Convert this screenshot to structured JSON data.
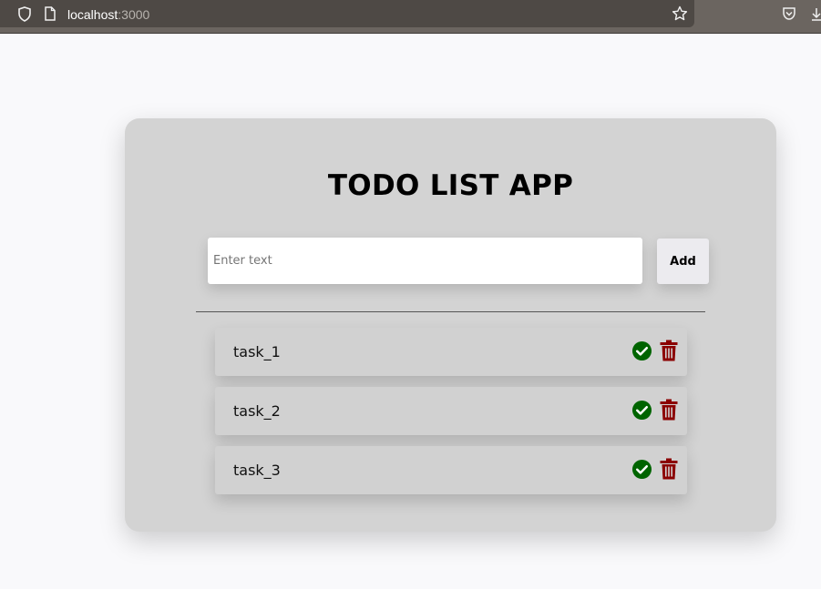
{
  "browser": {
    "url_host": "localhost",
    "url_port": ":3000"
  },
  "app": {
    "title": "TODO LIST APP",
    "input_placeholder": "Enter text",
    "input_value": "",
    "add_label": "Add"
  },
  "tasks": [
    {
      "label": "task_1"
    },
    {
      "label": "task_2"
    },
    {
      "label": "task_3"
    }
  ],
  "colors": {
    "complete": "#006400",
    "delete": "#8b0000",
    "card": "#d3d3d3"
  },
  "icons": {
    "complete": "check-circle-icon",
    "delete": "trash-icon"
  }
}
